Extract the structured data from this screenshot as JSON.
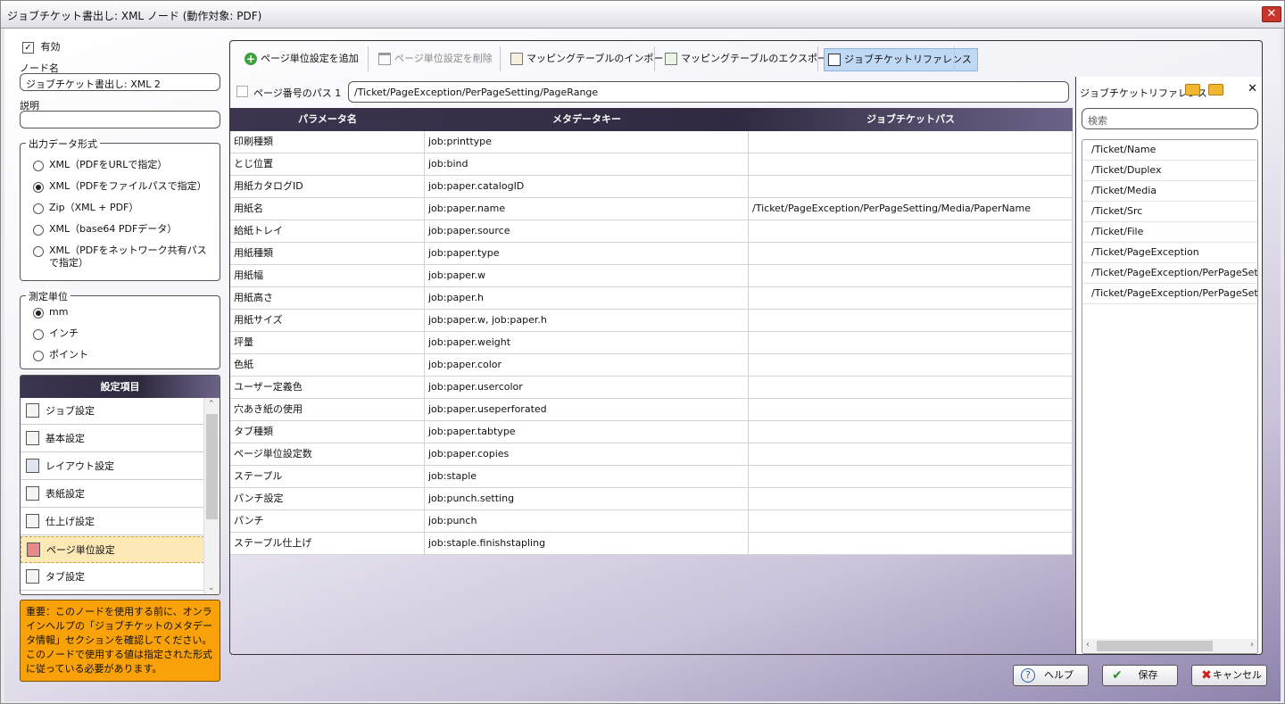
{
  "window": {
    "title": "ジョブチケット書出し: XML ノード (動作対象: PDF)",
    "close_glyph": "✕"
  },
  "left": {
    "enabled_label": "有効",
    "node_name_label": "ノード名",
    "node_name_value": "ジョブチケット書出し: XML 2",
    "description_label": "説明",
    "description_value": "",
    "output_group": {
      "title": "出力データ形式",
      "options": [
        {
          "label": "XML（PDFをURLで指定）",
          "selected": false
        },
        {
          "label": "XML（PDFをファイルパスで指定）",
          "selected": true
        },
        {
          "label": "Zip（XML + PDF）",
          "selected": false
        },
        {
          "label": "XML（base64 PDFデータ）",
          "selected": false
        },
        {
          "label": "XML（PDFをネットワーク共有パスで指定）",
          "selected": false
        }
      ]
    },
    "unit_group": {
      "title": "測定単位",
      "options": [
        {
          "label": "mm",
          "selected": true
        },
        {
          "label": "インチ",
          "selected": false
        },
        {
          "label": "ポイント",
          "selected": false
        }
      ]
    },
    "settings": {
      "title": "設定項目",
      "items": [
        "ジョブ設定",
        "基本設定",
        "レイアウト設定",
        "表紙設定",
        "仕上げ設定",
        "ページ単位設定",
        "タブ設定"
      ],
      "selected": "ページ単位設定"
    },
    "note": "重要：このノードを使用する前に、オンラインヘルプの「ジョブチケットのメタデータ情報」セクションを確認してください。このノードで使用する値は指定された形式に従っている必要があります。"
  },
  "toolbar": {
    "add": "ページ単位設定を追加",
    "delete": "ページ単位設定を削除",
    "import": "マッピングテーブルのインポート",
    "export": "マッピングテーブルのエクスポート",
    "reference": "ジョブチケットリファレンス"
  },
  "path": {
    "label": "ページ番号のパス 1",
    "value": "/Ticket/PageException/PerPageSetting/PageRange"
  },
  "table": {
    "headers": [
      "パラメータ名",
      "メタデータキー",
      "ジョブチケットパス"
    ],
    "rows": [
      [
        "印刷種類",
        "job:printtype",
        ""
      ],
      [
        "とじ位置",
        "job:bind",
        ""
      ],
      [
        "用紙カタログID",
        "job:paper.catalogID",
        ""
      ],
      [
        "用紙名",
        "job:paper.name",
        "/Ticket/PageException/PerPageSetting/Media/PaperName"
      ],
      [
        "給紙トレイ",
        "job:paper.source",
        ""
      ],
      [
        "用紙種類",
        "job:paper.type",
        ""
      ],
      [
        "用紙幅",
        "job:paper.w",
        ""
      ],
      [
        "用紙高さ",
        "job:paper.h",
        ""
      ],
      [
        "用紙サイズ",
        "job:paper.w, job:paper.h",
        ""
      ],
      [
        "坪量",
        "job:paper.weight",
        ""
      ],
      [
        "色紙",
        "job:paper.color",
        ""
      ],
      [
        "ユーザー定義色",
        "job:paper.usercolor",
        ""
      ],
      [
        "穴あき紙の使用",
        "job:paper.useperforated",
        ""
      ],
      [
        "タブ種類",
        "job:paper.tabtype",
        ""
      ],
      [
        "ページ単位設定数",
        "job:paper.copies",
        ""
      ],
      [
        "ステープル",
        "job:staple",
        ""
      ],
      [
        "パンチ設定",
        "job:punch.setting",
        ""
      ],
      [
        "パンチ",
        "job:punch",
        ""
      ],
      [
        "ステープル仕上げ",
        "job:staple.finishstapling",
        ""
      ]
    ]
  },
  "reference": {
    "title": "ジョブチケットリファレンス",
    "search_placeholder": "検索",
    "items": [
      "/Ticket/Name",
      "/Ticket/Duplex",
      "/Ticket/Media",
      "/Ticket/Src",
      "/Ticket/File",
      "/Ticket/PageException",
      "/Ticket/PageException/PerPageSetting",
      "/Ticket/PageException/PerPageSetting"
    ]
  },
  "buttons": {
    "help": "ヘルプ",
    "save": "保存",
    "cancel": "キャンセル"
  }
}
